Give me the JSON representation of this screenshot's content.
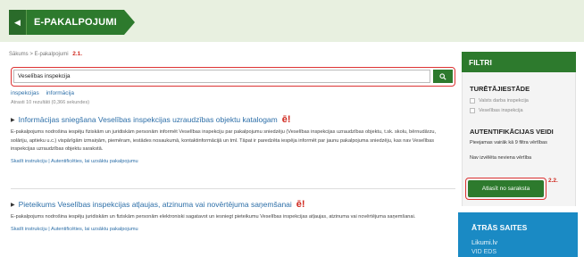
{
  "header": {
    "title": "E-PAKALPOJUMI"
  },
  "breadcrumb": {
    "text": "Sākums > E-pakalpojumi",
    "marker": "2.1."
  },
  "search": {
    "value": "Veselības inspekcija"
  },
  "tags": [
    "inspekcijas",
    "informācija"
  ],
  "found_text": "Atrasti 10 rezultāti (0,366 sekundes)",
  "results": [
    {
      "title": "Informācijas sniegšana Veselības inspekcijas uzraudzības objektu katalogam",
      "badge": "ē!",
      "desc": "E-pakalpojums nodrošina iespēju fiziskām un juridiskām personām informēt Veselības inspekciju par pakalpojumu sniedzēju (Veselības inspekcijas uzraudzības objektu, t.sk. skolu, bērnudārzu, solāriju, aptieku u.c.) vispārīgām izmaiņām, piemēram, iestādes nosaukumā, kontaktinformācijā un tml. Tāpat ir paredzēta iespēja informēt par jaunu pakalpojuma sniedzēju, kas nav Veselības inspekcijas uzraudzības objektu sarakstā.",
      "links": "Skatīt instrukciju | Autentificēties, lai uzsāktu pakalpojumu"
    },
    {
      "title": "Pieteikums Veselības inspekcijas atļaujas, atzinuma vai novērtējuma saņemšanai",
      "badge": "ē!",
      "desc": "E-pakalpojums nodrošina iespēju juridiskām un fiziskām personām elektroniski sagatavot un iesniegt pieteikumu Veselības inspekcijas atļaujas, atzinuma vai novērtējuma saņemšanai.",
      "links": "Skatīt instrukciju | Autentificēties, lai uzsāktu pakalpojumu"
    }
  ],
  "sidebar": {
    "title": "FILTRI",
    "section1_title": "TURĒTĀJIESTĀDE",
    "section1_options": [
      "Valsts darba inspekcija",
      "Veselības inspekcija"
    ],
    "section2_title": "AUTENTIFIKĀCIJAS VEIDI",
    "section2_note": "Pieejamas vairāk kā 9 filtra vērtības",
    "section2_empty": "Nav izvēlēta neviena vērtība",
    "apply_label": "Atlasīt no saraksta",
    "apply_marker": "2.2."
  },
  "quick_links": {
    "title": "ĀTRĀS SAITES",
    "items": [
      "Likumi.lv",
      "VID EDS"
    ]
  }
}
